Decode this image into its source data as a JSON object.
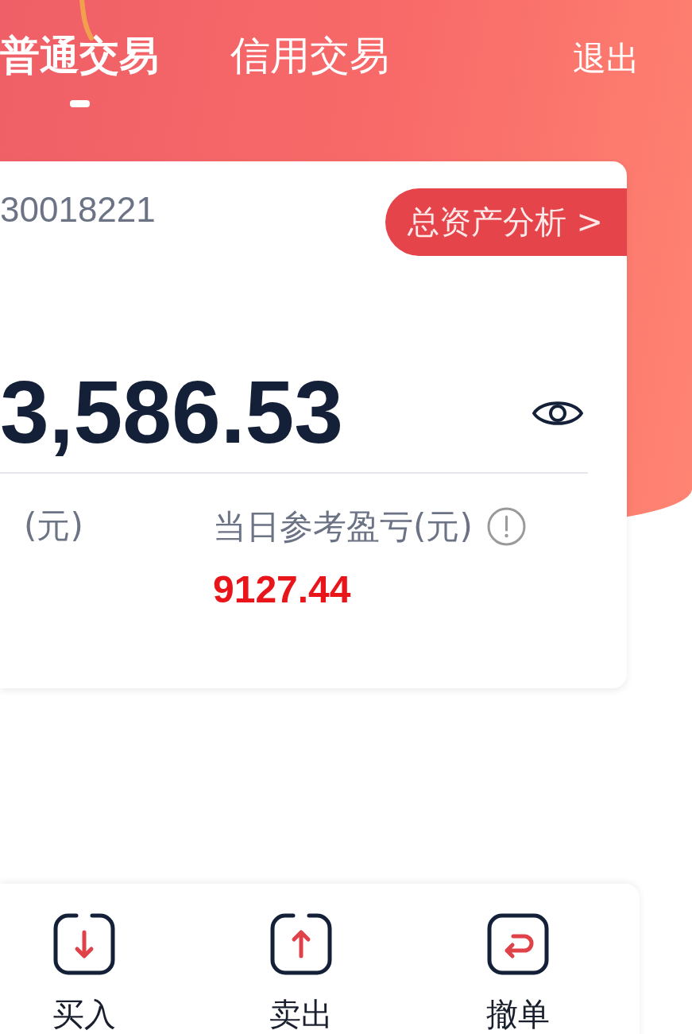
{
  "tabs": [
    {
      "label": "普通交易",
      "selected": true
    },
    {
      "label": "信用交易",
      "selected": false
    }
  ],
  "logout": "退出",
  "account": {
    "number": "30018221",
    "analysis_button": "总资产分析 >",
    "total_assets": "3,586.53",
    "stats": [
      {
        "label": "(元)",
        "info": false
      },
      {
        "label": "当日参考盈亏(元)",
        "info": true,
        "value": "9127.44"
      }
    ]
  },
  "actions": [
    {
      "kind": "buy",
      "label": "买入"
    },
    {
      "kind": "sell",
      "label": "卖出"
    },
    {
      "kind": "cancel",
      "label": "撤单"
    }
  ]
}
